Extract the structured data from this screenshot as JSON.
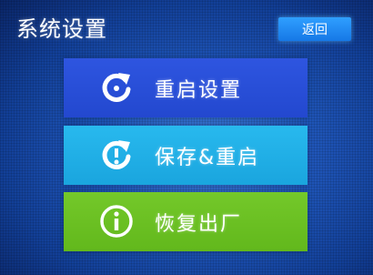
{
  "header": {
    "title": "系统设置",
    "back_label": "返回"
  },
  "menu": {
    "items": [
      {
        "label": "重启设置",
        "icon": "restart-icon",
        "color": "#2b50dc"
      },
      {
        "label": "保存&重启",
        "icon": "save-restart-icon",
        "color": "#22b0e8"
      },
      {
        "label": "恢复出厂",
        "icon": "info-icon",
        "color": "#6cc024"
      }
    ]
  }
}
